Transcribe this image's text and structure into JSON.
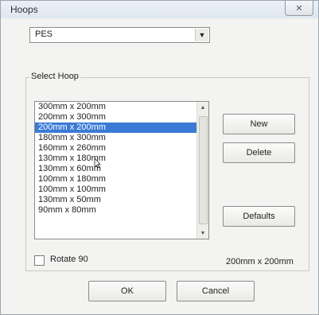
{
  "window": {
    "title": "Hoops",
    "close_label": "✕"
  },
  "format_select": {
    "value": "PES",
    "arrow": "▼"
  },
  "group": {
    "label": "Select Hoop"
  },
  "hoop_list": {
    "items": [
      "300mm x 200mm",
      "200mm x 300mm",
      "200mm x 200mm",
      "180mm x 300mm",
      "160mm x 260mm",
      "130mm x 180mm",
      "130mm x 60mm",
      "100mm x 180mm",
      "100mm x 100mm",
      "130mm x 50mm",
      "90mm x 80mm"
    ],
    "selected_index": 2
  },
  "buttons": {
    "new": "New",
    "delete": "Delete",
    "defaults": "Defaults",
    "ok": "OK",
    "cancel": "Cancel"
  },
  "rotate": {
    "label": "Rotate 90",
    "checked": false
  },
  "current_size": "200mm x 200mm",
  "icons": {
    "close": "close-icon",
    "dropdown": "chevron-down-icon",
    "scroll_up": "scroll-up-icon",
    "scroll_down": "scroll-down-icon",
    "cursor": "text-cursor-icon"
  }
}
